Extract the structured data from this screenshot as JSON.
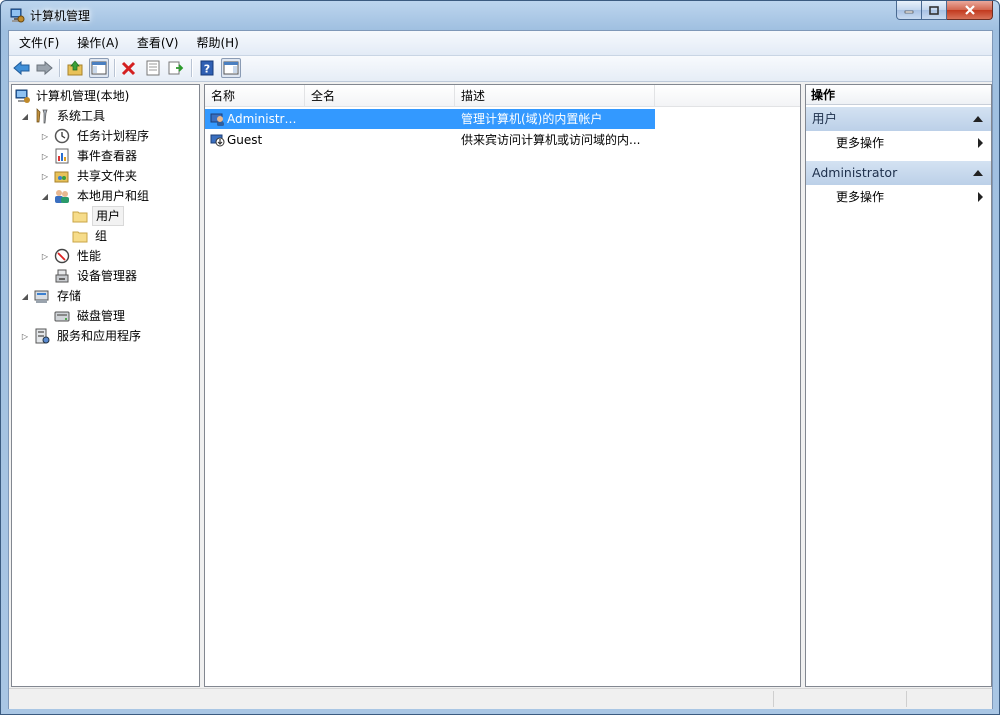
{
  "window": {
    "title": "计算机管理"
  },
  "menu": [
    "文件(F)",
    "操作(A)",
    "查看(V)",
    "帮助(H)"
  ],
  "toolbar": {
    "buttons": [
      "back-arrow-icon",
      "forward-arrow-icon",
      "up-folder-icon",
      "show-hide-tree-icon",
      "delete-icon",
      "properties-icon",
      "export-list-icon",
      "help-icon",
      "show-action-pane-icon"
    ]
  },
  "tree": {
    "root": "计算机管理(本地)",
    "system_tools": "系统工具",
    "task_scheduler": "任务计划程序",
    "event_viewer": "事件查看器",
    "shared_folders": "共享文件夹",
    "local_users_groups": "本地用户和组",
    "users": "用户",
    "groups": "组",
    "performance": "性能",
    "device_manager": "设备管理器",
    "storage": "存储",
    "disk_management": "磁盘管理",
    "services_apps": "服务和应用程序"
  },
  "list": {
    "columns": [
      "名称",
      "全名",
      "描述"
    ],
    "rows": [
      {
        "name": "Administrat...",
        "fullname": "",
        "description": "管理计算机(域)的内置帐户"
      },
      {
        "name": "Guest",
        "fullname": "",
        "description": "供来宾访问计算机或访问域的内..."
      }
    ]
  },
  "actions": {
    "title": "操作",
    "group1": "用户",
    "group1_more": "更多操作",
    "group2": "Administrator",
    "group2_more": "更多操作"
  },
  "colors": {
    "selection": "#3399ff",
    "action_header": "#bcd0e8",
    "window_frame": "#a9c6e4"
  }
}
